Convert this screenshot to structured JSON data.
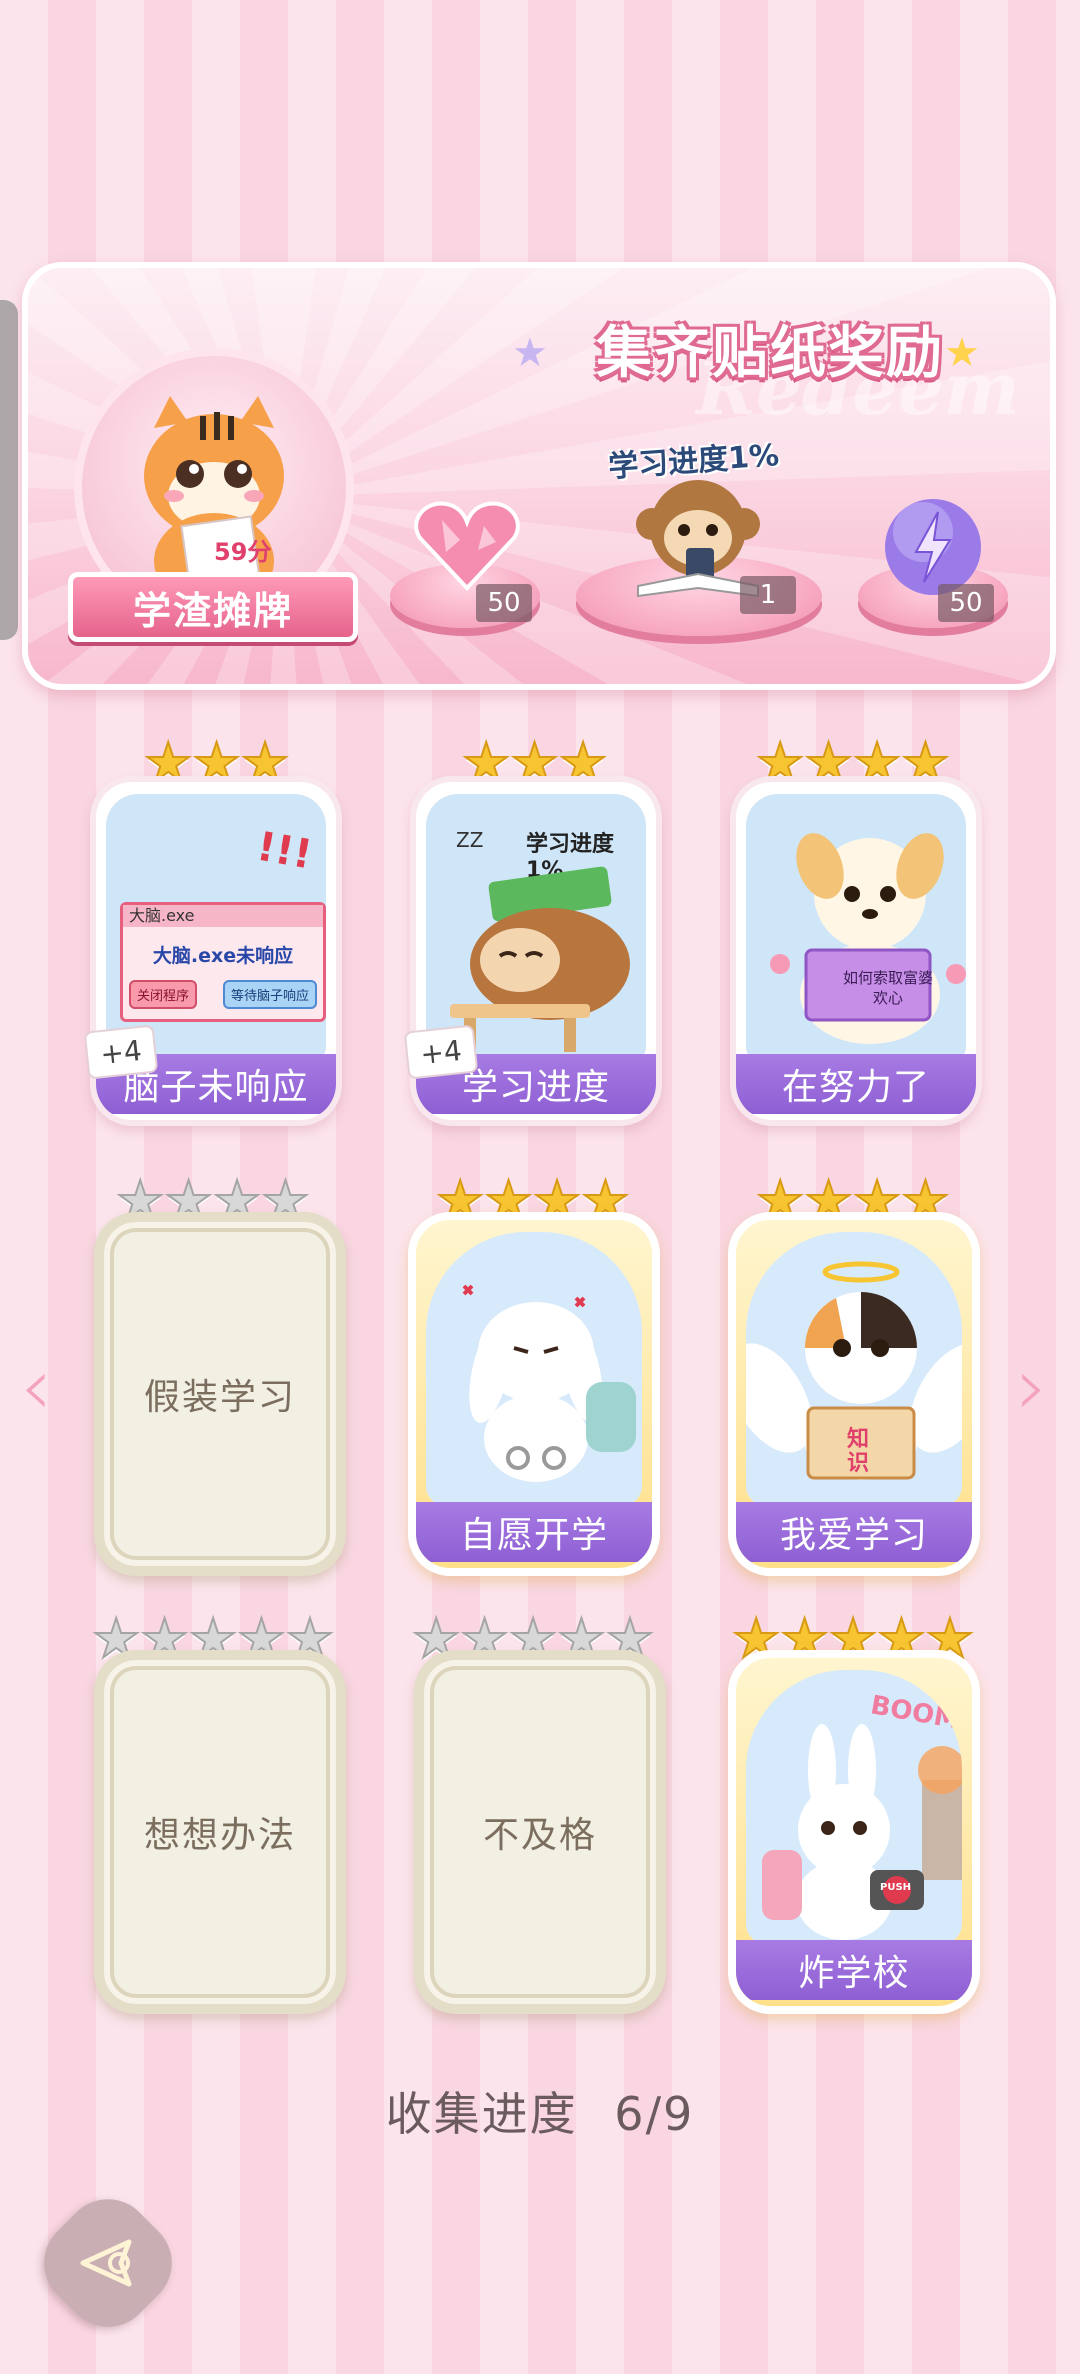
{
  "banner": {
    "title": "集齐贴纸奖励",
    "watermark": "Redeem",
    "badge_label": "学渣摊牌",
    "avatar_text": "59分",
    "rewards": [
      {
        "name": "pink-heart-gem",
        "count": "50"
      },
      {
        "name": "monkey-study-sticker",
        "caption": "学习进度1%",
        "count": "1"
      },
      {
        "name": "purple-lightning-orb",
        "count": "50"
      }
    ]
  },
  "cards": [
    {
      "name": "脑子未响应",
      "stars": 3,
      "star_total": 3,
      "state": "unlocked",
      "plus": "+4",
      "window_title": "大脑.exe",
      "window_msg": "大脑.exe未响应",
      "btn1": "关闭程序",
      "btn2": "等待脑子响应"
    },
    {
      "name": "学习进度",
      "stars": 3,
      "star_total": 3,
      "state": "unlocked",
      "plus": "+4",
      "art_text": "学习进度1%",
      "zz": "ZZ"
    },
    {
      "name": "在努力了",
      "stars": 4,
      "star_total": 4,
      "state": "unlocked",
      "book_text": "如何索取富婆欢心"
    },
    {
      "name": "假装学习",
      "stars": 0,
      "star_total": 4,
      "state": "locked"
    },
    {
      "name": "自愿开学",
      "stars": 4,
      "star_total": 4,
      "state": "gold"
    },
    {
      "name": "我爱学习",
      "stars": 4,
      "star_total": 4,
      "state": "gold",
      "book_text": "知识"
    },
    {
      "name": "想想办法",
      "stars": 0,
      "star_total": 5,
      "state": "locked"
    },
    {
      "name": "不及格",
      "stars": 0,
      "star_total": 5,
      "state": "locked"
    },
    {
      "name": "炸学校",
      "stars": 5,
      "star_total": 5,
      "state": "gold",
      "boom": "BOOM!!",
      "push": "PUSH"
    }
  ],
  "progress": {
    "label": "收集进度",
    "value": "6/9"
  },
  "icons": {
    "prev": "chevron-left-icon",
    "next": "chevron-right-icon",
    "back": "back-icon"
  },
  "colors": {
    "pink_bg": "#fce4ec",
    "label_purple": "#9a6bd9",
    "star_gold": "#f7c531"
  }
}
